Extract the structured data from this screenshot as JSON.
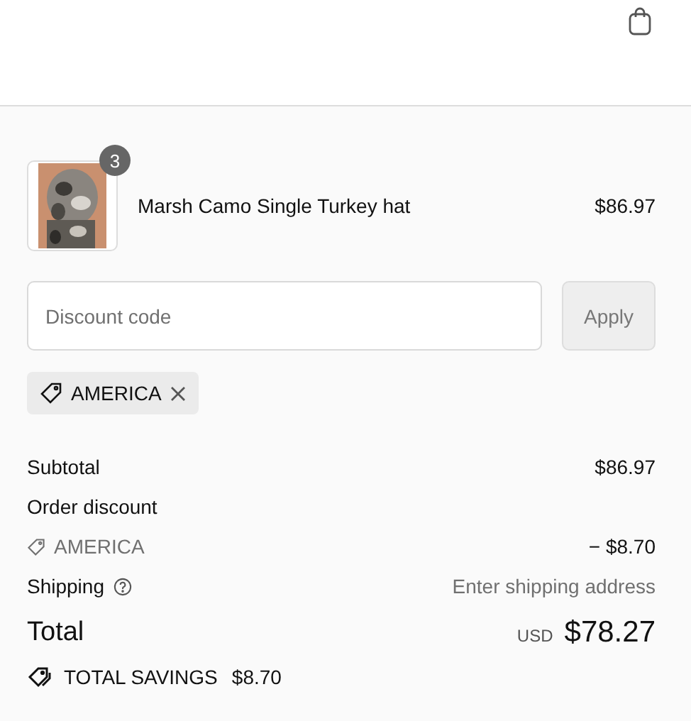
{
  "cart_item": {
    "quantity": "3",
    "name": "Marsh Camo Single Turkey hat",
    "price": "$86.97"
  },
  "discount_field": {
    "placeholder": "Discount code"
  },
  "apply_button": "Apply",
  "applied_codes": [
    {
      "code": "AMERICA"
    }
  ],
  "summary": [
    {
      "kind": "line",
      "label": "Subtotal",
      "value": "$86.97"
    },
    {
      "kind": "line",
      "label": "Order discount"
    },
    {
      "kind": "discount",
      "label": "AMERICA",
      "value": "− $8.70"
    },
    {
      "kind": "shipping",
      "label": "Shipping",
      "value": "Enter shipping address"
    }
  ],
  "total": {
    "label": "Total",
    "currency": "USD",
    "amount": "$78.27"
  },
  "savings": {
    "label": "TOTAL SAVINGS",
    "amount": "$8.70"
  }
}
